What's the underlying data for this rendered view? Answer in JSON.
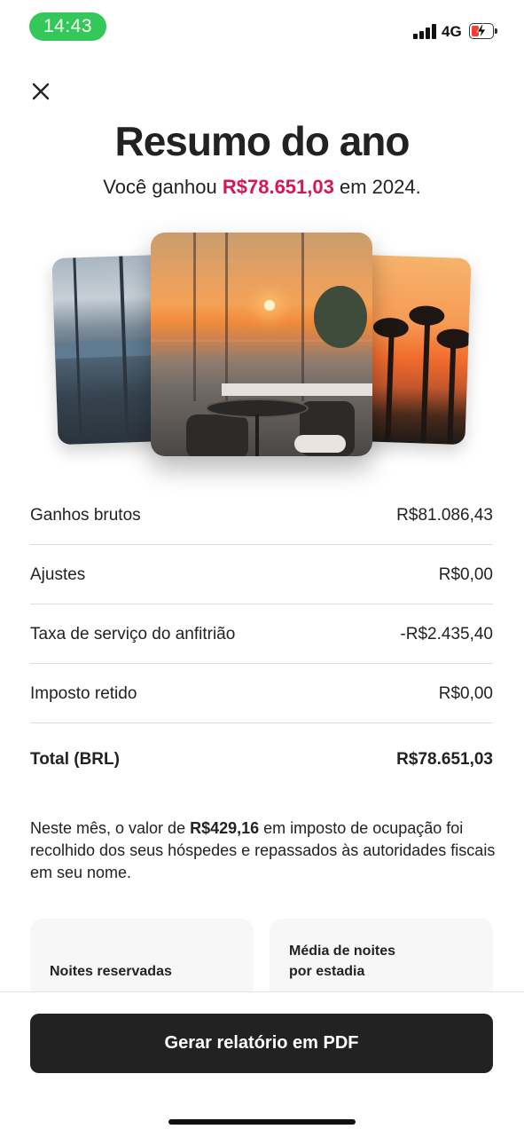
{
  "status_bar": {
    "time": "14:43",
    "network": "4G",
    "battery_level": 0.25,
    "battery_color": "#ff3b30",
    "time_pill_color": "#34c759"
  },
  "header": {
    "close_icon": "close-icon",
    "title": "Resumo do ano",
    "subtitle_prefix": "Você ganhou ",
    "subtitle_amount": "R$78.651,03",
    "subtitle_suffix": " em 2024.",
    "accent_color": "#d3185a"
  },
  "earnings": {
    "rows": [
      {
        "label": "Ganhos brutos",
        "value": "R$81.086,43"
      },
      {
        "label": "Ajustes",
        "value": "R$0,00"
      },
      {
        "label": "Taxa de serviço do anfitrião",
        "value": "-R$2.435,40"
      },
      {
        "label": "Imposto retido",
        "value": "R$0,00"
      }
    ],
    "total": {
      "label": "Total (BRL)",
      "value": "R$78.651,03"
    }
  },
  "note": {
    "prefix": "Neste mês, o valor de ",
    "amount": "R$429,16",
    "suffix": " em imposto de ocupação foi recolhido dos seus hóspedes e repassados às autoridades fiscais em seu nome."
  },
  "stats": [
    {
      "label": "Noites reservadas"
    },
    {
      "label_line1": "Média de noites",
      "label_line2": "por estadia"
    }
  ],
  "actions": {
    "pdf_button": "Gerar relatório em PDF",
    "button_color": "#222222"
  }
}
